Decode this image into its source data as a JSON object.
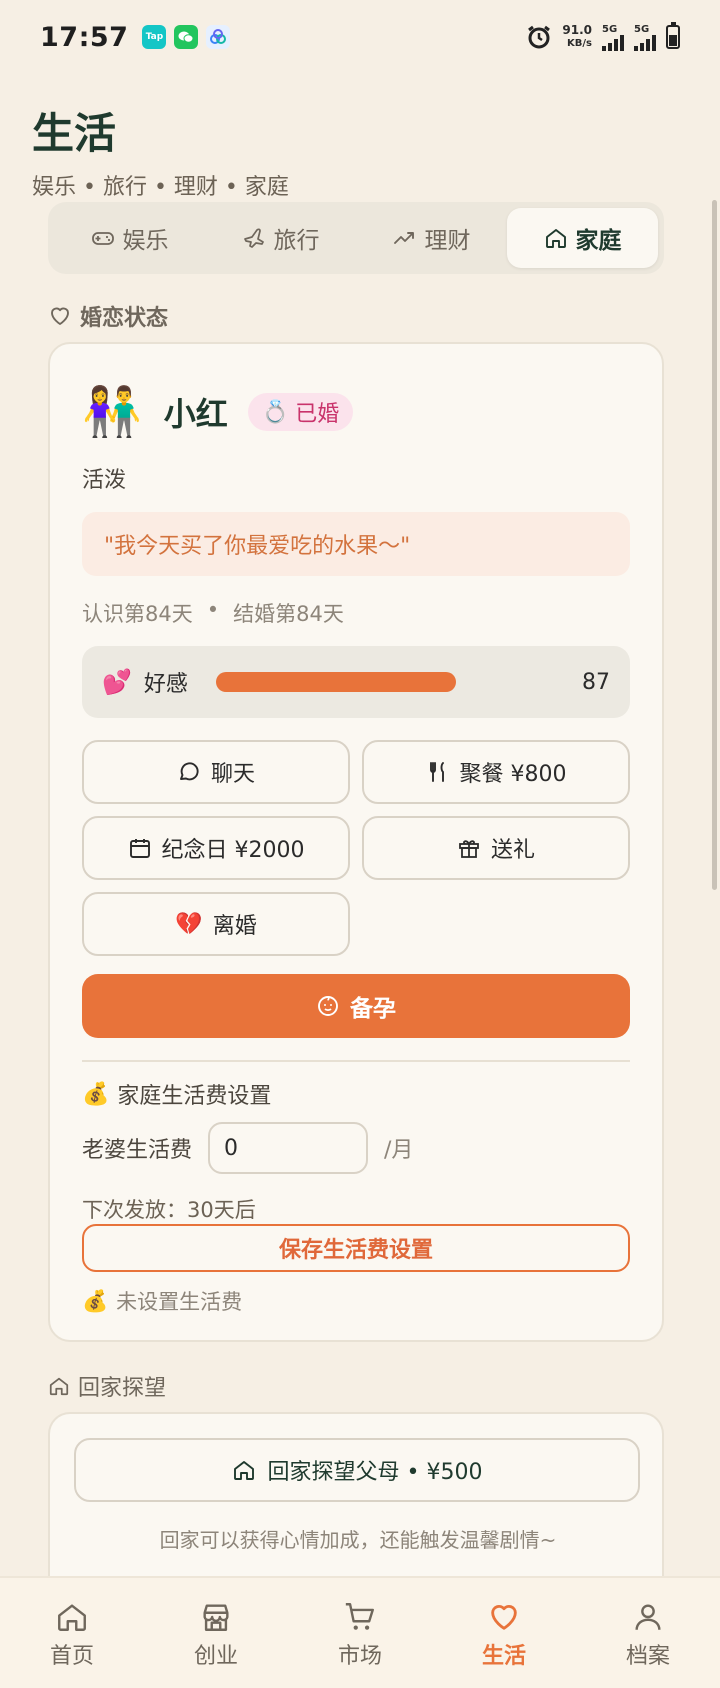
{
  "status_bar": {
    "time": "17:57",
    "apps": [
      {
        "icon": "taptap-icon",
        "text": "Tap",
        "color": "#14c6c6"
      },
      {
        "icon": "wechat-icon",
        "text": "",
        "color": "#22c55e"
      },
      {
        "icon": "cloud-app-icon",
        "text": "",
        "color": "#e6f0ff"
      }
    ],
    "net_speed_value": "91.0",
    "net_speed_unit": "KB/s",
    "signal1_label": "5G",
    "signal2_label": "5G"
  },
  "header": {
    "title": "生活",
    "subtitle": "娱乐 • 旅行 • 理财 • 家庭"
  },
  "tabs": [
    {
      "label": "娱乐",
      "icon": "gamepad-icon"
    },
    {
      "label": "旅行",
      "icon": "plane-icon"
    },
    {
      "label": "理财",
      "icon": "trend-up-icon"
    },
    {
      "label": "家庭",
      "icon": "home-icon",
      "active": true
    }
  ],
  "relationship": {
    "section_label": "婚恋状态",
    "avatar_emoji": "👫",
    "partner_name": "小红",
    "status_emoji": "💍",
    "status": "已婚",
    "personality": "活泼",
    "quote": "\"我今天买了你最爱吃的水果～\"",
    "known_days": "认识第84天",
    "dot": "•",
    "married_days": "结婚第84天",
    "affection": {
      "emoji": "💕",
      "label": "好感",
      "value": 87,
      "max": 100
    },
    "buttons": {
      "chat": "聊天",
      "dinner": "聚餐 ¥800",
      "anniversary": "纪念日 ¥2000",
      "gift": "送礼",
      "divorce_emoji": "💔",
      "divorce": "离婚",
      "prepare_baby": "备孕"
    },
    "allowance": {
      "emoji": "💰",
      "title": "家庭生活费设置",
      "label": "老婆生活费",
      "value": "0",
      "unit": "/月",
      "next_payment": "下次发放：30天后",
      "save_label": "保存生活费设置",
      "status_text": "未设置生活费"
    }
  },
  "visit_home": {
    "section_label": "回家探望",
    "button_label": "回家探望父母 • ¥500",
    "hint": "回家可以获得心情加成，还能触发温馨剧情~"
  },
  "bottom_nav": [
    {
      "label": "首页",
      "icon": "home-icon"
    },
    {
      "label": "创业",
      "icon": "store-icon"
    },
    {
      "label": "市场",
      "icon": "cart-icon"
    },
    {
      "label": "生活",
      "icon": "heart-icon",
      "active": true
    },
    {
      "label": "档案",
      "icon": "user-icon"
    }
  ],
  "colors": {
    "accent": "#e8733a",
    "background": "#f6efe4",
    "title": "#1f3a2e"
  }
}
